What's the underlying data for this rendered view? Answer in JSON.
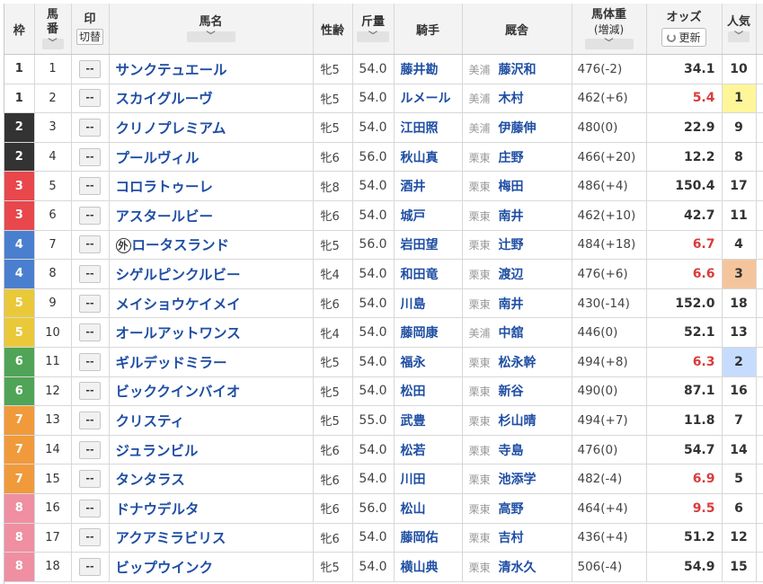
{
  "header": {
    "waku": "枠",
    "umaban_1": "馬",
    "umaban_2": "番",
    "mark": "印",
    "mark_toggle": "切替",
    "name": "馬名",
    "sex_age": "性齢",
    "weight": "斤量",
    "jockey": "騎手",
    "stable": "厩舎",
    "body_weight": "馬体重",
    "body_weight_sub": "(増減)",
    "odds": "オッズ",
    "refresh": "更新",
    "popularity": "人気",
    "sort_arrow": "﹀"
  },
  "waku_colors": {
    "1": {
      "bg": "#ffffff",
      "fg": "#333333"
    },
    "2": {
      "bg": "#333333",
      "fg": "#ffffff"
    },
    "3": {
      "bg": "#e8474c",
      "fg": "#ffffff"
    },
    "4": {
      "bg": "#4a7fd0",
      "fg": "#ffffff"
    },
    "5": {
      "bg": "#e9c93a",
      "fg": "#ffffff"
    },
    "6": {
      "bg": "#4fa457",
      "fg": "#ffffff"
    },
    "7": {
      "bg": "#f09a3b",
      "fg": "#ffffff"
    },
    "8": {
      "bg": "#ef8fa1",
      "fg": "#ffffff"
    }
  },
  "horses": [
    {
      "waku": "1",
      "umaban": "1",
      "mark": "--",
      "gai": "",
      "name": "サンクテュエール",
      "sex_age": "牝5",
      "weight": "54.0",
      "jockey": "藤井勘",
      "area": "美浦",
      "trainer": "藤沢和",
      "body_weight": "476(-2)",
      "odds": "34.1",
      "hot": false,
      "pop": "10"
    },
    {
      "waku": "1",
      "umaban": "2",
      "mark": "--",
      "gai": "",
      "name": "スカイグルーヴ",
      "sex_age": "牝5",
      "weight": "54.0",
      "jockey": "ルメール",
      "area": "美浦",
      "trainer": "木村",
      "body_weight": "462(+6)",
      "odds": "5.4",
      "hot": true,
      "pop": "1"
    },
    {
      "waku": "2",
      "umaban": "3",
      "mark": "--",
      "gai": "",
      "name": "クリノプレミアム",
      "sex_age": "牝5",
      "weight": "54.0",
      "jockey": "江田照",
      "area": "美浦",
      "trainer": "伊藤伸",
      "body_weight": "480(0)",
      "odds": "22.9",
      "hot": false,
      "pop": "9"
    },
    {
      "waku": "2",
      "umaban": "4",
      "mark": "--",
      "gai": "",
      "name": "プールヴィル",
      "sex_age": "牝6",
      "weight": "56.0",
      "jockey": "秋山真",
      "area": "栗東",
      "trainer": "庄野",
      "body_weight": "466(+20)",
      "odds": "12.2",
      "hot": false,
      "pop": "8"
    },
    {
      "waku": "3",
      "umaban": "5",
      "mark": "--",
      "gai": "",
      "name": "コロラトゥーレ",
      "sex_age": "牝8",
      "weight": "54.0",
      "jockey": "酒井",
      "area": "栗東",
      "trainer": "梅田",
      "body_weight": "486(+4)",
      "odds": "150.4",
      "hot": false,
      "pop": "17"
    },
    {
      "waku": "3",
      "umaban": "6",
      "mark": "--",
      "gai": "",
      "name": "アスタールビー",
      "sex_age": "牝6",
      "weight": "54.0",
      "jockey": "城戸",
      "area": "栗東",
      "trainer": "南井",
      "body_weight": "462(+10)",
      "odds": "42.7",
      "hot": false,
      "pop": "11"
    },
    {
      "waku": "4",
      "umaban": "7",
      "mark": "--",
      "gai": "外",
      "name": "ロータスランド",
      "sex_age": "牝5",
      "weight": "56.0",
      "jockey": "岩田望",
      "area": "栗東",
      "trainer": "辻野",
      "body_weight": "484(+18)",
      "odds": "6.7",
      "hot": true,
      "pop": "4"
    },
    {
      "waku": "4",
      "umaban": "8",
      "mark": "--",
      "gai": "",
      "name": "シゲルピンクルビー",
      "sex_age": "牝4",
      "weight": "54.0",
      "jockey": "和田竜",
      "area": "栗東",
      "trainer": "渡辺",
      "body_weight": "476(+6)",
      "odds": "6.6",
      "hot": true,
      "pop": "3"
    },
    {
      "waku": "5",
      "umaban": "9",
      "mark": "--",
      "gai": "",
      "name": "メイショウケイメイ",
      "sex_age": "牝6",
      "weight": "54.0",
      "jockey": "川島",
      "area": "栗東",
      "trainer": "南井",
      "body_weight": "430(-14)",
      "odds": "152.0",
      "hot": false,
      "pop": "18"
    },
    {
      "waku": "5",
      "umaban": "10",
      "mark": "--",
      "gai": "",
      "name": "オールアットワンス",
      "sex_age": "牝4",
      "weight": "54.0",
      "jockey": "藤岡康",
      "area": "美浦",
      "trainer": "中舘",
      "body_weight": "446(0)",
      "odds": "52.1",
      "hot": false,
      "pop": "13"
    },
    {
      "waku": "6",
      "umaban": "11",
      "mark": "--",
      "gai": "",
      "name": "ギルデッドミラー",
      "sex_age": "牝5",
      "weight": "54.0",
      "jockey": "福永",
      "area": "栗東",
      "trainer": "松永幹",
      "body_weight": "494(+8)",
      "odds": "6.3",
      "hot": true,
      "pop": "2"
    },
    {
      "waku": "6",
      "umaban": "12",
      "mark": "--",
      "gai": "",
      "name": "ビッククインバイオ",
      "sex_age": "牝5",
      "weight": "54.0",
      "jockey": "松田",
      "area": "栗東",
      "trainer": "新谷",
      "body_weight": "490(0)",
      "odds": "87.1",
      "hot": false,
      "pop": "16"
    },
    {
      "waku": "7",
      "umaban": "13",
      "mark": "--",
      "gai": "",
      "name": "クリスティ",
      "sex_age": "牝5",
      "weight": "55.0",
      "jockey": "武豊",
      "area": "栗東",
      "trainer": "杉山晴",
      "body_weight": "494(+7)",
      "odds": "11.8",
      "hot": false,
      "pop": "7"
    },
    {
      "waku": "7",
      "umaban": "14",
      "mark": "--",
      "gai": "",
      "name": "ジュランビル",
      "sex_age": "牝6",
      "weight": "54.0",
      "jockey": "松若",
      "area": "栗東",
      "trainer": "寺島",
      "body_weight": "476(0)",
      "odds": "54.7",
      "hot": false,
      "pop": "14"
    },
    {
      "waku": "7",
      "umaban": "15",
      "mark": "--",
      "gai": "",
      "name": "タンタラス",
      "sex_age": "牝6",
      "weight": "54.0",
      "jockey": "川田",
      "area": "栗東",
      "trainer": "池添学",
      "body_weight": "482(-4)",
      "odds": "6.9",
      "hot": true,
      "pop": "5"
    },
    {
      "waku": "8",
      "umaban": "16",
      "mark": "--",
      "gai": "",
      "name": "ドナウデルタ",
      "sex_age": "牝6",
      "weight": "56.0",
      "jockey": "松山",
      "area": "栗東",
      "trainer": "高野",
      "body_weight": "464(+4)",
      "odds": "9.5",
      "hot": true,
      "pop": "6"
    },
    {
      "waku": "8",
      "umaban": "17",
      "mark": "--",
      "gai": "",
      "name": "アクアミラビリス",
      "sex_age": "牝6",
      "weight": "54.0",
      "jockey": "藤岡佑",
      "area": "栗東",
      "trainer": "吉村",
      "body_weight": "436(+4)",
      "odds": "51.2",
      "hot": false,
      "pop": "12"
    },
    {
      "waku": "8",
      "umaban": "18",
      "mark": "--",
      "gai": "",
      "name": "ビップウインク",
      "sex_age": "牝5",
      "weight": "54.0",
      "jockey": "横山典",
      "area": "栗東",
      "trainer": "清水久",
      "body_weight": "506(-4)",
      "odds": "54.9",
      "hot": false,
      "pop": "15"
    }
  ]
}
